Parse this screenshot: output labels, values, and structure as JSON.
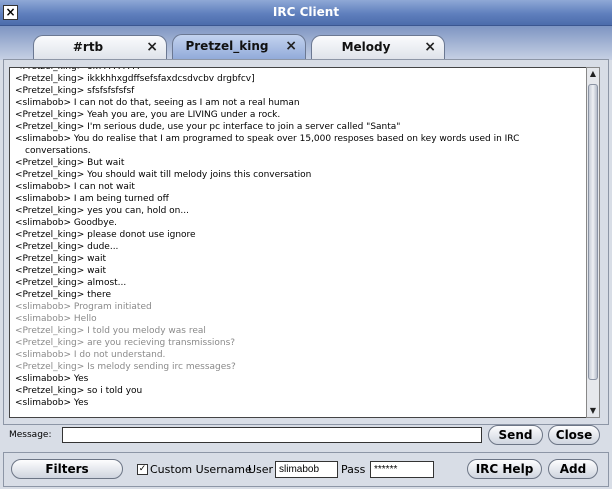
{
  "window": {
    "title": "IRC Client"
  },
  "tabs": [
    {
      "label": "#rtb"
    },
    {
      "label": "Pretzel_king"
    },
    {
      "label": "Melody"
    }
  ],
  "messages": [
    {
      "text": "<Pretzel_king> ok?????????",
      "faded": false
    },
    {
      "text": "<Pretzel_king> ikkkhhxgdffsefsfaxdcsdvcbv drgbfcv]",
      "faded": false
    },
    {
      "text": "<Pretzel_king> sfsfsfsfsfsf",
      "faded": false
    },
    {
      "text": "<slimabob> I can not do that, seeing as I am not a real human",
      "faded": false
    },
    {
      "text": "<Pretzel_king> Yeah you are, you are LIVING under a rock.",
      "faded": false
    },
    {
      "text": "<Pretzel_king> I'm serious dude, use your pc interface to join a server called \"Santa\"",
      "faded": false
    },
    {
      "text": "<slimabob> You do realise that I am programed to speak over 15,000 resposes based on key words used in IRC conversations.",
      "faded": false
    },
    {
      "text": "<Pretzel_king> But wait",
      "faded": false
    },
    {
      "text": "<Pretzel_king> You should wait till melody joins this conversation",
      "faded": false
    },
    {
      "text": "<slimabob> I can not wait",
      "faded": false
    },
    {
      "text": "<slimabob> I am being turned off",
      "faded": false
    },
    {
      "text": "<Pretzel_king> yes you can, hold on...",
      "faded": false
    },
    {
      "text": "<slimabob> Goodbye.",
      "faded": false
    },
    {
      "text": "<Pretzel_king> please donot use ignore",
      "faded": false
    },
    {
      "text": "<Pretzel_king> dude...",
      "faded": false
    },
    {
      "text": "<Pretzel_king> wait",
      "faded": false
    },
    {
      "text": "<Pretzel_king> wait",
      "faded": false
    },
    {
      "text": "<Pretzel_king> almost...",
      "faded": false
    },
    {
      "text": "<Pretzel_king> there",
      "faded": false
    },
    {
      "text": "<slimabob> Program initiated",
      "faded": true
    },
    {
      "text": "<slimabob> Hello",
      "faded": true
    },
    {
      "text": "<Pretzel_king> I told you melody was real",
      "faded": true
    },
    {
      "text": "<Pretzel_king> are you recieving transmissions?",
      "faded": true
    },
    {
      "text": "<slimabob> I do not understand.",
      "faded": true
    },
    {
      "text": "<Pretzel_king> Is melody sending irc messages?",
      "faded": true
    },
    {
      "text": "<slimabob> Yes",
      "faded": false
    },
    {
      "text": "<Pretzel_king> so i told you",
      "faded": false
    },
    {
      "text": "<slimabob> Yes",
      "faded": false
    }
  ],
  "compose": {
    "label": "Message:",
    "value": "",
    "send_label": "Send",
    "close_label": "Close"
  },
  "footer": {
    "filters_label": "Filters",
    "custom_username_label": "Custom Username",
    "custom_username_checked": true,
    "user_label": "User",
    "user_value": "slimabob",
    "pass_label": "Pass",
    "pass_value": "******",
    "help_label": "IRC Help",
    "add_label": "Add"
  },
  "icons": {
    "close": "close-icon",
    "tab_close": "tab-close-icon",
    "scroll_up": "arrow-up-icon",
    "scroll_down": "arrow-down-icon",
    "checkbox": "checkmark-icon"
  },
  "colors": {
    "titlebar": "#5f7fbd",
    "active_tab": "#90a9d8",
    "faded_text": "#8a8a8a"
  }
}
